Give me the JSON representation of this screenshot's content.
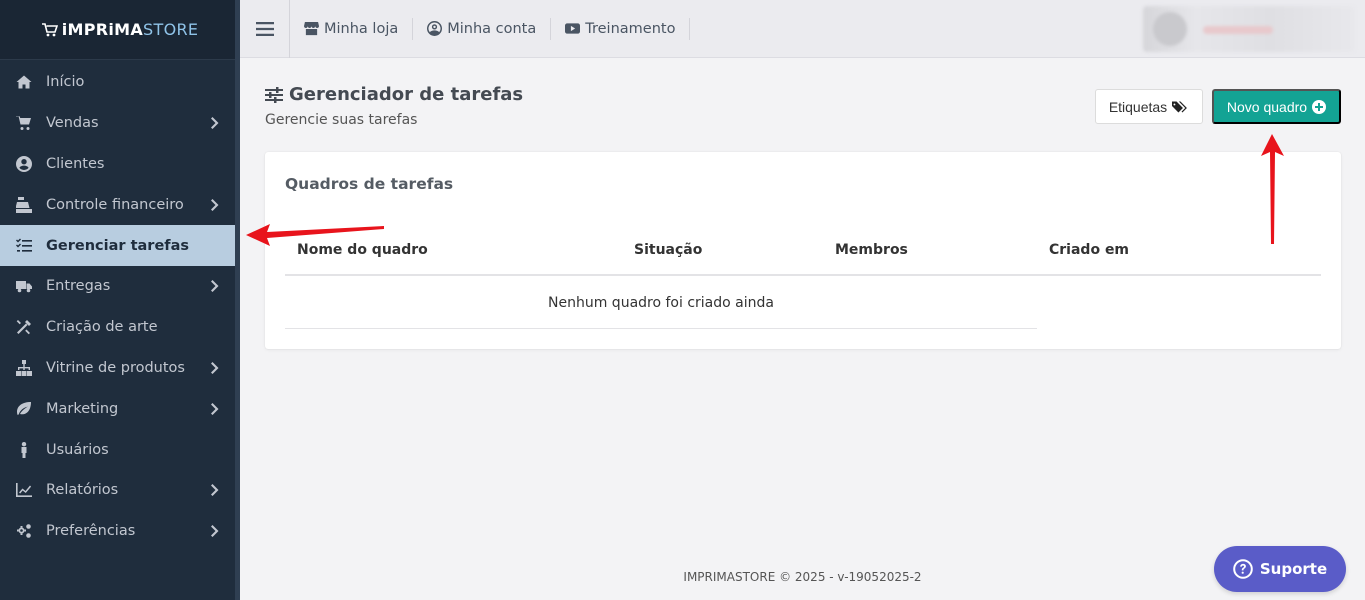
{
  "brand": {
    "bold": "iMPRiMA",
    "light": "STORE"
  },
  "sidebar": {
    "items": [
      {
        "label": "Início",
        "icon": "home-icon",
        "chevron": false,
        "active": false
      },
      {
        "label": "Vendas",
        "icon": "cart-icon",
        "chevron": true,
        "active": false
      },
      {
        "label": "Clientes",
        "icon": "user-circle-icon",
        "chevron": false,
        "active": false
      },
      {
        "label": "Controle financeiro",
        "icon": "cash-register-icon",
        "chevron": true,
        "active": false
      },
      {
        "label": "Gerenciar tarefas",
        "icon": "task-list-icon",
        "chevron": false,
        "active": true
      },
      {
        "label": "Entregas",
        "icon": "truck-icon",
        "chevron": true,
        "active": false
      },
      {
        "label": "Criação de arte",
        "icon": "tools-icon",
        "chevron": false,
        "active": false
      },
      {
        "label": "Vitrine de produtos",
        "icon": "sitemap-icon",
        "chevron": true,
        "active": false
      },
      {
        "label": "Marketing",
        "icon": "leaf-icon",
        "chevron": true,
        "active": false
      },
      {
        "label": "Usuários",
        "icon": "person-icon",
        "chevron": false,
        "active": false
      },
      {
        "label": "Relatórios",
        "icon": "chart-line-icon",
        "chevron": true,
        "active": false
      },
      {
        "label": "Preferências",
        "icon": "gears-icon",
        "chevron": true,
        "active": false
      }
    ]
  },
  "topbar": {
    "links": [
      {
        "label": "Minha loja",
        "icon": "store-icon"
      },
      {
        "label": "Minha conta",
        "icon": "account-circle-icon"
      },
      {
        "label": "Treinamento",
        "icon": "youtube-icon"
      }
    ]
  },
  "page": {
    "title": "Gerenciador de tarefas",
    "subtitle": "Gerencie suas tarefas",
    "btn_tags": "Etiquetas",
    "btn_new": "Novo quadro"
  },
  "card": {
    "title": "Quadros de tarefas",
    "columns": [
      "Nome do quadro",
      "Situação",
      "Membros",
      "Criado em"
    ],
    "empty_message": "Nenhum quadro foi criado ainda"
  },
  "footer": {
    "text": "IMPRIMASTORE © 2025 - v-19052025-2"
  },
  "support": {
    "label": "Suporte"
  },
  "colors": {
    "sidebar_bg": "#1f2d3d",
    "sidebar_active": "#b8cde0",
    "primary_button": "#13a394",
    "support_button": "#5a5cc8",
    "annotation_arrow": "#e8141c"
  }
}
